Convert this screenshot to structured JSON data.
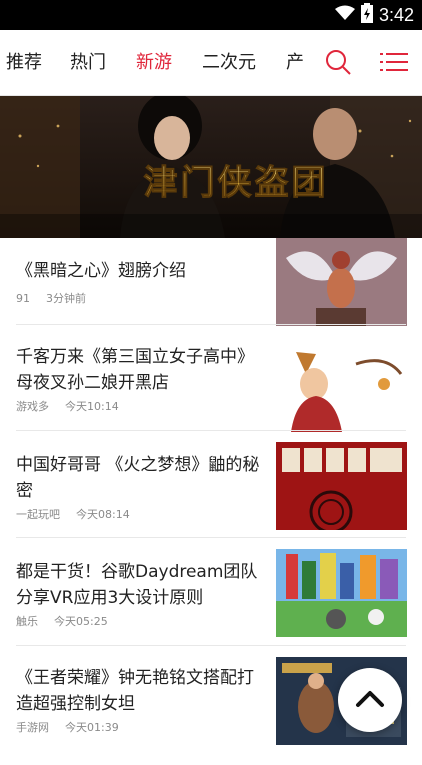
{
  "status_bar": {
    "time": "3:42",
    "wifi_icon": "wifi-icon",
    "battery_icon": "battery-icon"
  },
  "nav": {
    "tabs": [
      {
        "label": "推荐",
        "active": false
      },
      {
        "label": "热门",
        "active": false
      },
      {
        "label": "新游",
        "active": true
      },
      {
        "label": "二次元",
        "active": false
      },
      {
        "label": "产业",
        "active": false
      }
    ],
    "search_icon": "search-icon",
    "menu_icon": "menu-icon",
    "accent_color": "#e0263b"
  },
  "banner": {
    "title": "津门侠盗团"
  },
  "articles": [
    {
      "title": "《黑暗之心》翅膀介绍",
      "source": "91",
      "time": "3分钟前"
    },
    {
      "title": "千客万来《第三国立女子高中》母夜叉孙二娘开黑店",
      "source": "游戏多",
      "time": "今天10:14"
    },
    {
      "title": "中国好哥哥 《火之梦想》鼬的秘密",
      "source": "一起玩吧",
      "time": "今天08:14"
    },
    {
      "title": "都是干货！谷歌Daydream团队分享VR应用3大设计原则",
      "source": "触乐",
      "time": "今天05:25"
    },
    {
      "title": "《王者荣耀》钟无艳铭文搭配打造超强控制女坦",
      "source": "手游网",
      "time": "今天01:39"
    }
  ],
  "fab_icon": "chevron-up-icon"
}
